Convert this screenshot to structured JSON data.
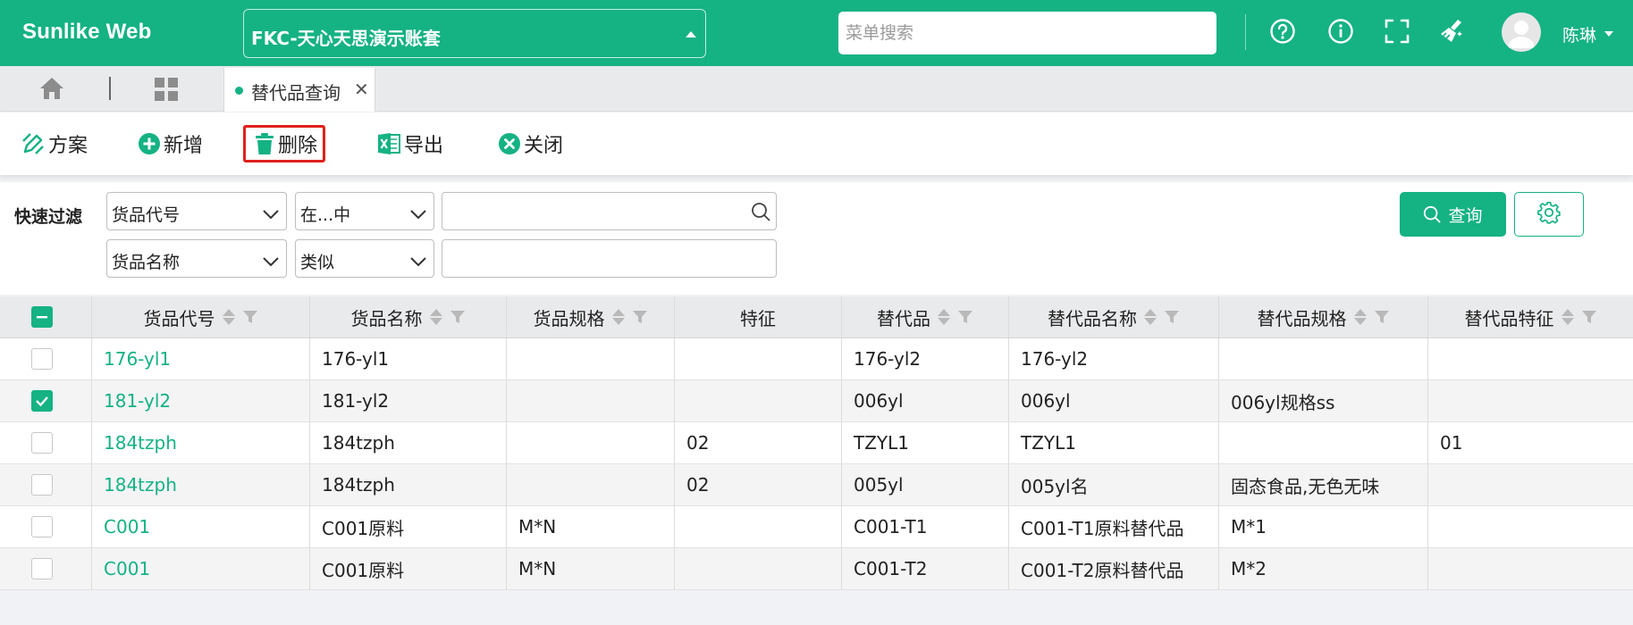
{
  "app": {
    "brand": "Sunlike Web",
    "account": "FKC-天心天思演示账套",
    "search_placeholder": "菜单搜索",
    "user_name": "陈琳"
  },
  "tabs": [
    {
      "label": "替代品查询",
      "active": true
    }
  ],
  "toolbar": {
    "plan_label": "方案",
    "add_label": "新增",
    "delete_label": "删除",
    "export_label": "导出",
    "close_label": "关闭"
  },
  "filter": {
    "label": "快速过滤",
    "rows": [
      {
        "field": "货品代号",
        "operator": "在...中",
        "value": ""
      },
      {
        "field": "货品名称",
        "operator": "类似",
        "value": ""
      }
    ],
    "query_label": "查询"
  },
  "table": {
    "columns": [
      "货品代号",
      "货品名称",
      "货品规格",
      "特征",
      "替代品",
      "替代品名称",
      "替代品规格",
      "替代品特征"
    ],
    "rows": [
      {
        "checked": false,
        "cells": [
          "176-yl1",
          "176-yl1",
          "",
          "",
          "176-yl2",
          "176-yl2",
          "",
          ""
        ]
      },
      {
        "checked": true,
        "cells": [
          "181-yl2",
          "181-yl2",
          "",
          "",
          "006yl",
          "006yl",
          "006yl规格ss",
          ""
        ]
      },
      {
        "checked": false,
        "cells": [
          "184tzph",
          "184tzph",
          "",
          "02",
          "TZYL1",
          "TZYL1",
          "",
          "01"
        ]
      },
      {
        "checked": false,
        "cells": [
          "184tzph",
          "184tzph",
          "",
          "02",
          "005yl",
          "005yl名",
          "固态食品,无色无味",
          ""
        ]
      },
      {
        "checked": false,
        "cells": [
          "C001",
          "C001原料",
          "M*N",
          "",
          "C001-T1",
          "C001-T1原料替代品",
          "M*1",
          ""
        ]
      },
      {
        "checked": false,
        "cells": [
          "C001",
          "C001原料",
          "M*N",
          "",
          "C001-T2",
          "C001-T2原料替代品",
          "M*2",
          ""
        ]
      }
    ]
  },
  "colors": {
    "primary": "#15b284",
    "highlight_border": "#e0201c"
  }
}
